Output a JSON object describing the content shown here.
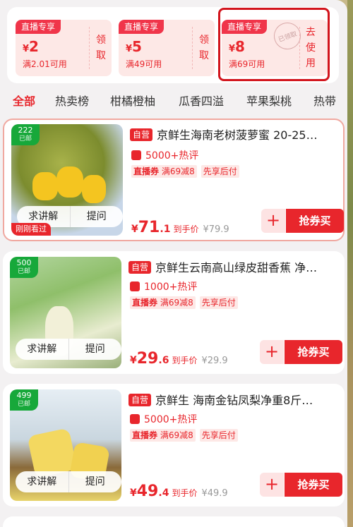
{
  "coupons": [
    {
      "tag": "直播专享",
      "currency": "¥",
      "amount": "2",
      "condition": "满2.01可用",
      "action": "领取"
    },
    {
      "tag": "直播专享",
      "currency": "¥",
      "amount": "5",
      "condition": "满49可用",
      "action": "领取"
    },
    {
      "tag": "直播专享",
      "currency": "¥",
      "amount": "8",
      "condition": "满69可用",
      "action": "去使用",
      "stamp": "已领取"
    }
  ],
  "tabs": [
    "全部",
    "热卖榜",
    "柑橘橙柚",
    "瓜香四溢",
    "苹果梨桃",
    "热带"
  ],
  "products": [
    {
      "rank": "222",
      "rank_sub": "已邮",
      "badge": "自营",
      "title": "京鲜生海南老树菠萝蜜 20-25…",
      "hot": "5000+热评",
      "promo_tag": "直播券",
      "promo_value": "满69减8",
      "promo_pay": "先享后付",
      "price_int": "71",
      "price_dec": ".1",
      "price_label": "到手价",
      "orig_price": "¥79.9",
      "ask_explain": "求讲解",
      "ask_question": "提问",
      "recent": "刚刚看过",
      "add": "+",
      "buy": "抢券买"
    },
    {
      "rank": "500",
      "rank_sub": "已邮",
      "badge": "自营",
      "title": "京鲜生云南高山绿皮甜香蕉 净…",
      "hot": "1000+热评",
      "promo_tag": "直播券",
      "promo_value": "满69减8",
      "promo_pay": "先享后付",
      "price_int": "29",
      "price_dec": ".6",
      "price_label": "到手价",
      "orig_price": "¥29.9",
      "ask_explain": "求讲解",
      "ask_question": "提问",
      "add": "+",
      "buy": "抢券买"
    },
    {
      "rank": "499",
      "rank_sub": "已邮",
      "badge": "自营",
      "title": "京鲜生 海南金钻凤梨净重8斤…",
      "hot": "5000+热评",
      "promo_tag": "直播券",
      "promo_value": "满69减8",
      "promo_pay": "先享后付",
      "price_int": "49",
      "price_dec": ".4",
      "price_label": "到手价",
      "orig_price": "¥49.9",
      "ask_explain": "求讲解",
      "ask_question": "提问",
      "add": "+",
      "buy": "抢券买"
    }
  ],
  "colors": {
    "accent": "#e8262c",
    "rank_badge": "#17a83a",
    "background": "#f3f1f2"
  }
}
